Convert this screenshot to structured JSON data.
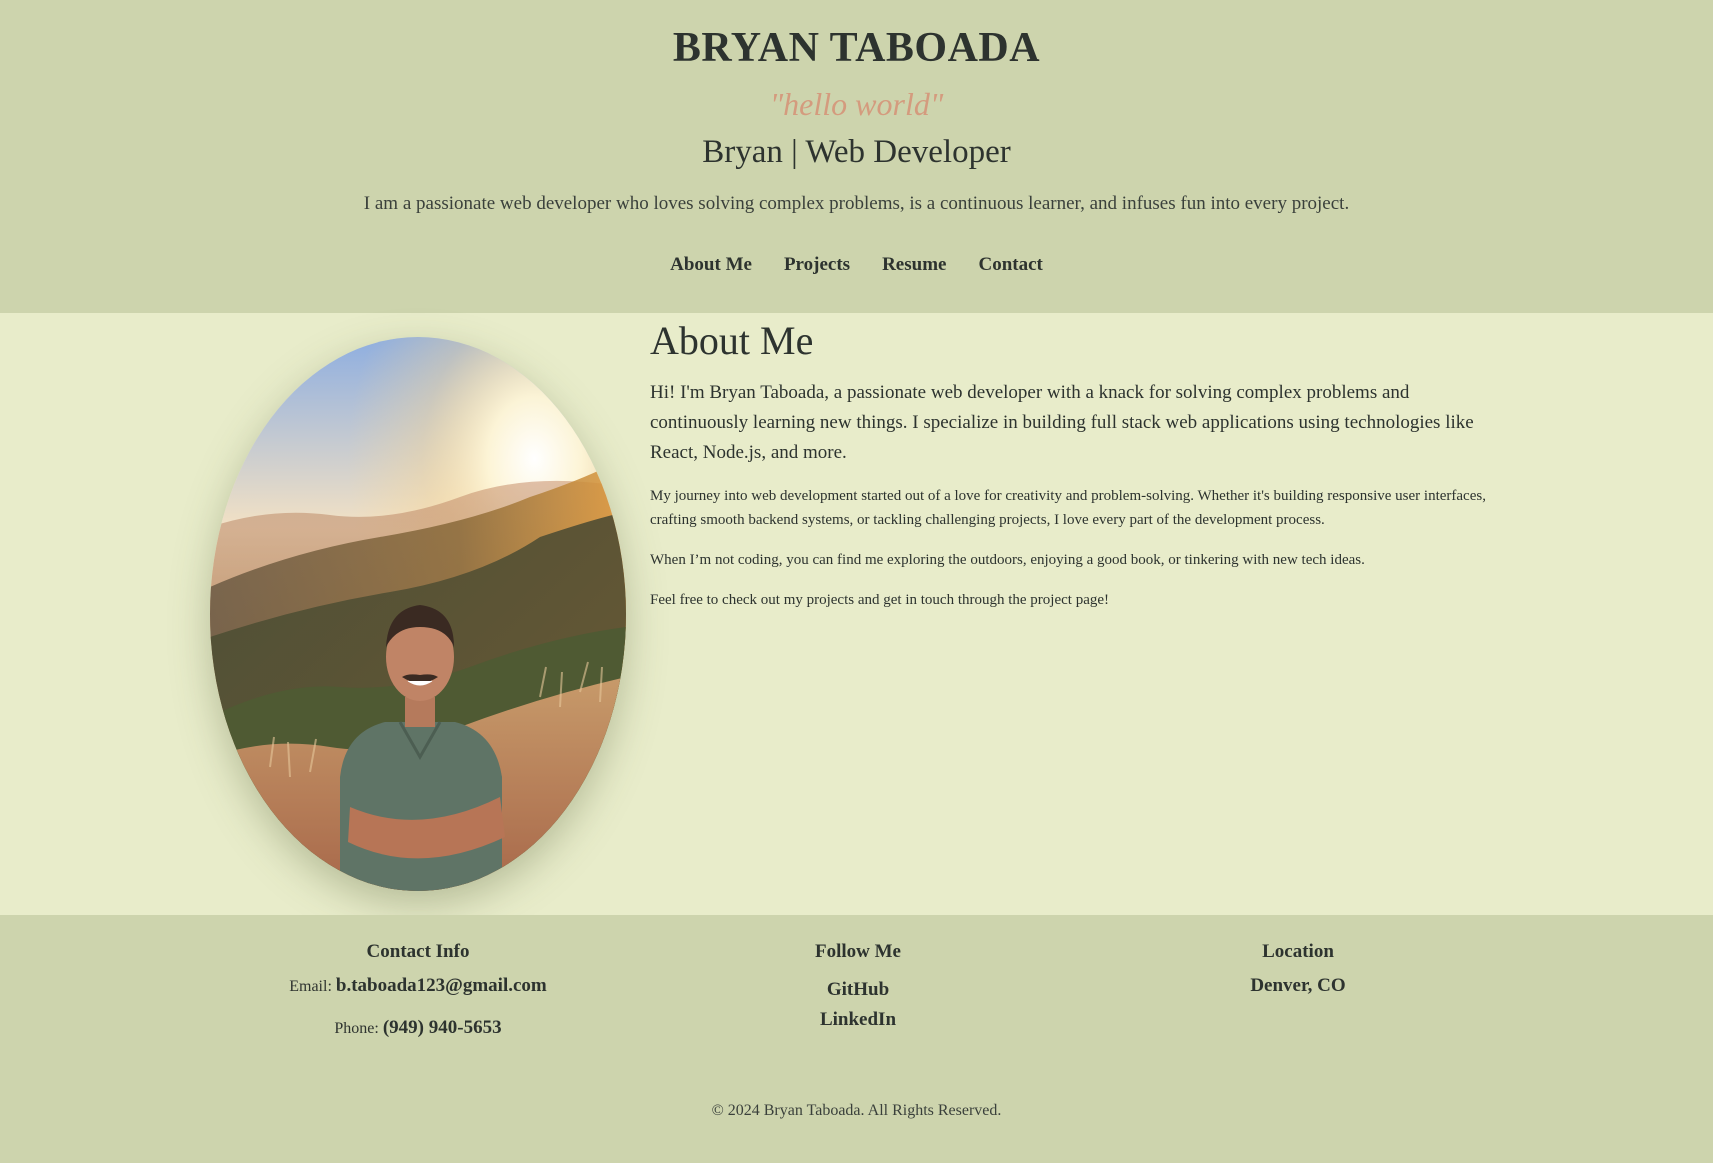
{
  "header": {
    "title": "BRYAN TABOADA",
    "tagline": "\"hello world\"",
    "role": "Bryan | Web Developer",
    "intro": "I am a passionate web developer who loves solving complex problems, is a continuous learner, and infuses fun into every project."
  },
  "nav": {
    "items": [
      {
        "label": "About Me"
      },
      {
        "label": "Projects"
      },
      {
        "label": "Resume"
      },
      {
        "label": "Contact"
      }
    ]
  },
  "about": {
    "heading": "About Me",
    "lead": "Hi! I'm Bryan Taboada, a passionate web developer with a knack for solving complex problems and continuously learning new things. I specialize in building full stack web applications using technologies like React, Node.js, and more.",
    "paragraphs": [
      "My journey into web development started out of a love for creativity and problem-solving. Whether it's building responsive user interfaces, crafting smooth backend systems, or tackling challenging projects, I love every part of the development process.",
      "When I’m not coding, you can find me exploring the outdoors, enjoying a good book, or tinkering with new tech ideas.",
      "Feel free to check out my projects and get in touch through the project page!"
    ]
  },
  "footer": {
    "contact": {
      "heading": "Contact Info",
      "email_label": "Email:",
      "email": "b.taboada123@gmail.com",
      "phone_label": "Phone:",
      "phone": "(949) 940-5653"
    },
    "follow": {
      "heading": "Follow Me",
      "links": [
        {
          "label": "GitHub"
        },
        {
          "label": "LinkedIn"
        }
      ]
    },
    "location": {
      "heading": "Location",
      "value": "Denver, CO"
    },
    "copyright": "© 2024 Bryan Taboada. All Rights Reserved."
  },
  "colors": {
    "header_bg": "#cdd4ad",
    "main_bg": "#e8ecca",
    "tagline": "#d49b7e",
    "text": "#2d332f"
  }
}
